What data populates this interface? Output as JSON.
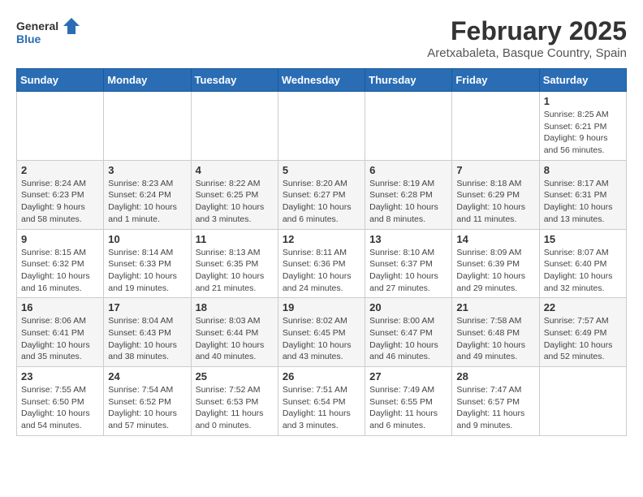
{
  "header": {
    "logo_general": "General",
    "logo_blue": "Blue",
    "title": "February 2025",
    "subtitle": "Aretxabaleta, Basque Country, Spain"
  },
  "weekdays": [
    "Sunday",
    "Monday",
    "Tuesday",
    "Wednesday",
    "Thursday",
    "Friday",
    "Saturday"
  ],
  "weeks": [
    [
      {
        "day": "",
        "info": ""
      },
      {
        "day": "",
        "info": ""
      },
      {
        "day": "",
        "info": ""
      },
      {
        "day": "",
        "info": ""
      },
      {
        "day": "",
        "info": ""
      },
      {
        "day": "",
        "info": ""
      },
      {
        "day": "1",
        "info": "Sunrise: 8:25 AM\nSunset: 6:21 PM\nDaylight: 9 hours and 56 minutes."
      }
    ],
    [
      {
        "day": "2",
        "info": "Sunrise: 8:24 AM\nSunset: 6:23 PM\nDaylight: 9 hours and 58 minutes."
      },
      {
        "day": "3",
        "info": "Sunrise: 8:23 AM\nSunset: 6:24 PM\nDaylight: 10 hours and 1 minute."
      },
      {
        "day": "4",
        "info": "Sunrise: 8:22 AM\nSunset: 6:25 PM\nDaylight: 10 hours and 3 minutes."
      },
      {
        "day": "5",
        "info": "Sunrise: 8:20 AM\nSunset: 6:27 PM\nDaylight: 10 hours and 6 minutes."
      },
      {
        "day": "6",
        "info": "Sunrise: 8:19 AM\nSunset: 6:28 PM\nDaylight: 10 hours and 8 minutes."
      },
      {
        "day": "7",
        "info": "Sunrise: 8:18 AM\nSunset: 6:29 PM\nDaylight: 10 hours and 11 minutes."
      },
      {
        "day": "8",
        "info": "Sunrise: 8:17 AM\nSunset: 6:31 PM\nDaylight: 10 hours and 13 minutes."
      }
    ],
    [
      {
        "day": "9",
        "info": "Sunrise: 8:15 AM\nSunset: 6:32 PM\nDaylight: 10 hours and 16 minutes."
      },
      {
        "day": "10",
        "info": "Sunrise: 8:14 AM\nSunset: 6:33 PM\nDaylight: 10 hours and 19 minutes."
      },
      {
        "day": "11",
        "info": "Sunrise: 8:13 AM\nSunset: 6:35 PM\nDaylight: 10 hours and 21 minutes."
      },
      {
        "day": "12",
        "info": "Sunrise: 8:11 AM\nSunset: 6:36 PM\nDaylight: 10 hours and 24 minutes."
      },
      {
        "day": "13",
        "info": "Sunrise: 8:10 AM\nSunset: 6:37 PM\nDaylight: 10 hours and 27 minutes."
      },
      {
        "day": "14",
        "info": "Sunrise: 8:09 AM\nSunset: 6:39 PM\nDaylight: 10 hours and 29 minutes."
      },
      {
        "day": "15",
        "info": "Sunrise: 8:07 AM\nSunset: 6:40 PM\nDaylight: 10 hours and 32 minutes."
      }
    ],
    [
      {
        "day": "16",
        "info": "Sunrise: 8:06 AM\nSunset: 6:41 PM\nDaylight: 10 hours and 35 minutes."
      },
      {
        "day": "17",
        "info": "Sunrise: 8:04 AM\nSunset: 6:43 PM\nDaylight: 10 hours and 38 minutes."
      },
      {
        "day": "18",
        "info": "Sunrise: 8:03 AM\nSunset: 6:44 PM\nDaylight: 10 hours and 40 minutes."
      },
      {
        "day": "19",
        "info": "Sunrise: 8:02 AM\nSunset: 6:45 PM\nDaylight: 10 hours and 43 minutes."
      },
      {
        "day": "20",
        "info": "Sunrise: 8:00 AM\nSunset: 6:47 PM\nDaylight: 10 hours and 46 minutes."
      },
      {
        "day": "21",
        "info": "Sunrise: 7:58 AM\nSunset: 6:48 PM\nDaylight: 10 hours and 49 minutes."
      },
      {
        "day": "22",
        "info": "Sunrise: 7:57 AM\nSunset: 6:49 PM\nDaylight: 10 hours and 52 minutes."
      }
    ],
    [
      {
        "day": "23",
        "info": "Sunrise: 7:55 AM\nSunset: 6:50 PM\nDaylight: 10 hours and 54 minutes."
      },
      {
        "day": "24",
        "info": "Sunrise: 7:54 AM\nSunset: 6:52 PM\nDaylight: 10 hours and 57 minutes."
      },
      {
        "day": "25",
        "info": "Sunrise: 7:52 AM\nSunset: 6:53 PM\nDaylight: 11 hours and 0 minutes."
      },
      {
        "day": "26",
        "info": "Sunrise: 7:51 AM\nSunset: 6:54 PM\nDaylight: 11 hours and 3 minutes."
      },
      {
        "day": "27",
        "info": "Sunrise: 7:49 AM\nSunset: 6:55 PM\nDaylight: 11 hours and 6 minutes."
      },
      {
        "day": "28",
        "info": "Sunrise: 7:47 AM\nSunset: 6:57 PM\nDaylight: 11 hours and 9 minutes."
      },
      {
        "day": "",
        "info": ""
      }
    ]
  ]
}
